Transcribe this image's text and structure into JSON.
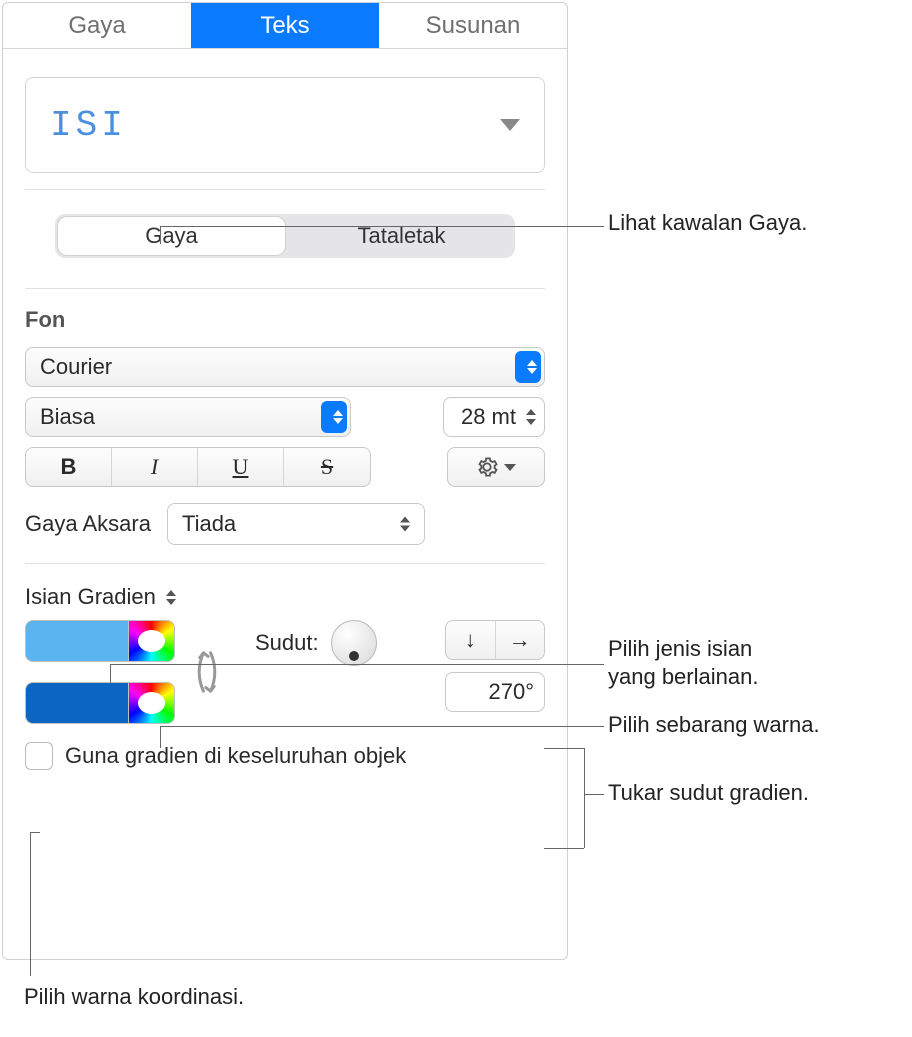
{
  "top_tabs": {
    "gaya": "Gaya",
    "teks": "Teks",
    "susunan": "Susunan"
  },
  "style_preview": "ISI",
  "sub_tabs": {
    "gaya": "Gaya",
    "tataletak": "Tataletak"
  },
  "font": {
    "section": "Fon",
    "family": "Courier",
    "weight": "Biasa",
    "size": "28 mt",
    "buttons": {
      "bold": "B",
      "italic": "I",
      "underline": "U",
      "strike": "S"
    },
    "char_style_label": "Gaya Aksara",
    "char_style_value": "Tiada"
  },
  "fill": {
    "type_label": "Isian Gradien",
    "angle_label": "Sudut:",
    "angle_value": "270°",
    "dir_down": "↓",
    "dir_right": "→",
    "checkbox_label": "Guna gradien di keseluruhan objek",
    "color1": "#5bb3f0",
    "color2": "#0a66c2"
  },
  "callouts": {
    "c1": "Lihat kawalan Gaya.",
    "c2a": "Pilih jenis isian",
    "c2b": "yang berlainan.",
    "c3": "Pilih sebarang warna.",
    "c4": "Tukar sudut gradien.",
    "c5": "Pilih warna koordinasi."
  }
}
